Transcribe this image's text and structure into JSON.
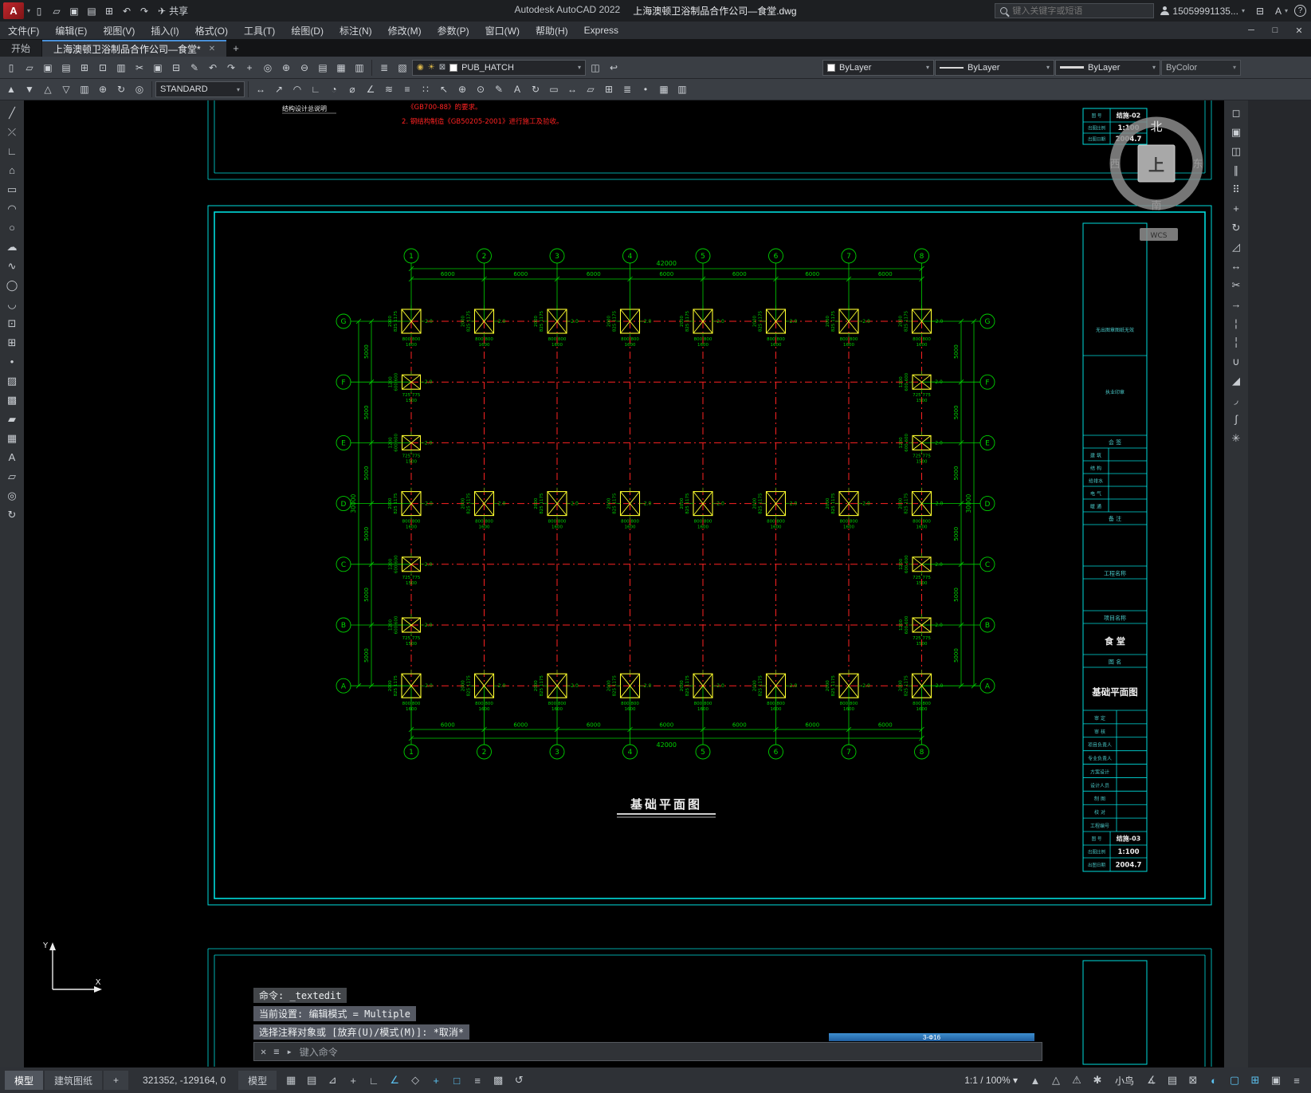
{
  "colors": {
    "axis_green": "#00d200",
    "centerline_red": "#ff2222",
    "foundation_yellow": "#ffff2e",
    "sheet_cyan": "#00dcdc",
    "titleblock_teal": "#49c8c8",
    "text_white": "#ededed"
  },
  "titlebar": {
    "logo": "A",
    "quick_icons": [
      "new-file",
      "open-file",
      "save-file",
      "save-as-file",
      "plot-file",
      "undo",
      "redo"
    ],
    "share_label": "共享",
    "app_title": "Autodesk AutoCAD 2022",
    "doc_title": "上海澳顿卫浴制品合作公司—食堂.dwg",
    "search_placeholder": "键入关键字或短语",
    "account": "15059991135...",
    "help_label": "?",
    "window": {
      "min": "─",
      "max": "□",
      "close": "✕"
    }
  },
  "menubar": {
    "items": [
      "文件(F)",
      "编辑(E)",
      "视图(V)",
      "插入(I)",
      "格式(O)",
      "工具(T)",
      "绘图(D)",
      "标注(N)",
      "修改(M)",
      "参数(P)",
      "窗口(W)",
      "帮助(H)",
      "Express"
    ]
  },
  "tabs": {
    "start": "开始",
    "document": "上海澳顿卫浴制品合作公司—食堂*",
    "new_tab": "+"
  },
  "toolbar1": {
    "icons_left": [
      "qnew",
      "open",
      "save",
      "save-as",
      "plot",
      "plot-preview",
      "publish",
      "cut",
      "copy-clip",
      "paste",
      "match-properties",
      "undo",
      "redo",
      "pan-realtime",
      "zoom-realtime",
      "zoom-window",
      "zoom-previous",
      "properties",
      "design-center",
      "tool-palettes"
    ],
    "layer_icons": [
      "layer-properties",
      "layer-states-manager"
    ],
    "layer_control": {
      "value": "PUB_HATCH"
    },
    "layer_after_icons": [
      "make-object-layer-current",
      "layer-previous"
    ],
    "color_value": "ByLayer",
    "linetype_value": "ByLayer",
    "lineweight_value": "ByLayer",
    "plotstyle_value": "ByColor"
  },
  "toolbar2": {
    "icons_left": [
      "draw-order-front",
      "draw-order-back",
      "bring-above",
      "send-under",
      "named-views",
      "zoom-extents",
      "regen",
      "redraw"
    ],
    "text_style": "STANDARD",
    "icons_right": [
      "linear-dimension",
      "aligned-dimension",
      "arc-length-dimension",
      "ordinate-dimension",
      "radius-dimension",
      "diameter-dimension",
      "angular-dimension",
      "quick-dimension",
      "baseline-dimension",
      "continue-dimension",
      "quick-leader",
      "tolerance",
      "center-mark",
      "dimension-edit",
      "dimension-text-edit",
      "dimension-update",
      "dimension-style",
      "distance",
      "area",
      "region-mass",
      "list",
      "locate-point",
      "quick-calc",
      "named-views"
    ]
  },
  "left_toolbar": [
    "line",
    "construction-line",
    "polyline",
    "polygon",
    "rectangle",
    "arc",
    "circle",
    "revision-cloud",
    "spline",
    "ellipse",
    "ellipse-arc",
    "insert-block",
    "create-block",
    "point",
    "hatch",
    "gradient",
    "region",
    "table",
    "multiline-text",
    "wipeout",
    "donut",
    "helix"
  ],
  "right_toolbar": [
    "erase",
    "copy",
    "mirror",
    "offset",
    "array",
    "move",
    "rotate",
    "scale",
    "stretch",
    "trim",
    "extend",
    "break-at-point",
    "break",
    "join",
    "chamfer",
    "fillet",
    "blend-curves",
    "explode"
  ],
  "canvas": {
    "notes_red": [
      "《GB700-88》的要求。",
      "2. 钢结构制造《GB50205-2001》进行施工及验收。"
    ],
    "above_sheet_label": "结构设计总说明",
    "viewcube": {
      "north": "北",
      "south": "南",
      "east": "东",
      "west": "西",
      "top": "上",
      "wcs": "WCS"
    },
    "ucs_icon": {
      "x_label": "X",
      "y_label": "Y"
    },
    "titleblock_above": {
      "rows": [
        {
          "label": "图  号",
          "value": "结施-02"
        },
        {
          "label": "出图比例",
          "value": "1:100"
        },
        {
          "label": "出图日期",
          "value": "2004.7"
        }
      ]
    },
    "titleblock": {
      "stamp_note": "无出图章图纸无效",
      "seal_note": "执业印章",
      "signoff_header": "会  签",
      "disciplines": [
        "建  筑",
        "结  构",
        "给排水",
        "电  气",
        "暖  通"
      ],
      "remark_header": "备  注",
      "project_header": "工程名称",
      "item_header": "项目名称",
      "item_value": "食  堂",
      "sheetname_header": "图  名",
      "sheetname_value": "基础平面图",
      "sign_rows": [
        "审  定",
        "审  核",
        "项目负责人",
        "专业负责人",
        "方案设计",
        "设计人员",
        "制  图",
        "校  对",
        "工程编号"
      ],
      "bottom_rows": [
        {
          "label": "图  号",
          "value": "结施-03"
        },
        {
          "label": "出图比例",
          "value": "1:100"
        },
        {
          "label": "出图日期",
          "value": "2004.7"
        }
      ]
    },
    "plan": {
      "title": "基础平面图",
      "col_axes": [
        "1",
        "2",
        "3",
        "4",
        "5",
        "6",
        "7",
        "8"
      ],
      "row_axes": [
        "G",
        "F",
        "E",
        "D",
        "C",
        "B",
        "A"
      ],
      "bay_width_label": "6000",
      "bay_height_label": "5000",
      "total_width_label": "42000",
      "total_height_label": "30000",
      "full_foundation_rows": [
        0,
        3,
        6
      ],
      "edge_foundation_rows": [
        1,
        2,
        4,
        5
      ],
      "edge_foundation_cols": [
        0,
        7
      ],
      "big_foundation": {
        "width_halves": "800 800",
        "width_total": "1600",
        "height_halves": "825 1175",
        "height_total": "2000",
        "tag": "2.0"
      },
      "small_foundation": {
        "width_halves": "725 775",
        "width_total": "1500",
        "height_halves": "600 600",
        "height_total": "1200",
        "tag": "2.0"
      }
    }
  },
  "command": {
    "history": [
      "命令: _textedit",
      "当前设置: 编辑模式 = Multiple",
      "选择注释对象或 [放弃(U)/模式(M)]: *取消*"
    ],
    "input_placeholder": "键入命令",
    "edit_overlay": "3-Ф16"
  },
  "statusbar": {
    "layout_tabs": [
      "模型",
      "建筑图纸",
      "+"
    ],
    "coordinates": "321352, -129164, 0",
    "model_label": "模型",
    "toggle_icons": [
      {
        "name": "grid-display",
        "active": false
      },
      {
        "name": "snap-mode",
        "active": false
      },
      {
        "name": "infer-constraints",
        "active": false
      },
      {
        "name": "dynamic-input",
        "active": false
      },
      {
        "name": "ortho-mode",
        "active": false
      },
      {
        "name": "polar-tracking",
        "active": true
      },
      {
        "name": "isometric-drafting",
        "active": false
      },
      {
        "name": "object-snap-tracking",
        "active": true
      },
      {
        "name": "object-snap",
        "active": true
      },
      {
        "name": "show-lineweight",
        "active": false
      },
      {
        "name": "transparency",
        "active": false
      },
      {
        "name": "selection-cycling",
        "active": false
      }
    ],
    "annotation_scale": "1:1 / 100% ▾",
    "right_icons": [
      {
        "name": "annotation-visibility",
        "active": false
      },
      {
        "name": "annotation-autoscale",
        "active": false
      },
      {
        "name": "annotation-monitor",
        "active": false
      },
      {
        "name": "workspace-switching",
        "active": false
      }
    ],
    "plugin_label": "小鸟",
    "right_icons2": [
      {
        "name": "units",
        "active": false
      },
      {
        "name": "quick-properties",
        "active": false
      },
      {
        "name": "lock-ui",
        "active": false
      },
      {
        "name": "isolate-objects",
        "active": true
      },
      {
        "name": "graphics-performance",
        "active": true
      },
      {
        "name": "clean-screen",
        "active": true
      },
      {
        "name": "display-settings",
        "active": false
      },
      {
        "name": "customize-menu",
        "active": false
      }
    ]
  }
}
